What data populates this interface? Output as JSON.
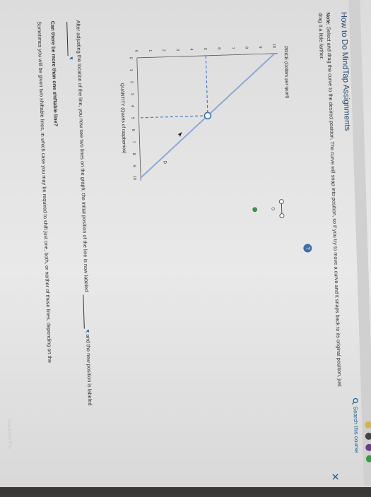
{
  "header": {
    "title": "How to Do MindTap Assignments",
    "search_label": "Search this course",
    "close_glyph": "✕",
    "rail_letter": "s"
  },
  "note": {
    "label": "Note",
    "text": ": Select and drag the curve to the desired position. The curve will snap into position, so if you try to move a curve and it snaps back to its original position, just drag it a little farther."
  },
  "help_glyph": "?",
  "chart_data": {
    "type": "line",
    "ylabel": "PRICE (Dollars per quart)",
    "xlabel": "QUANTITY (Quarts of raspberries)",
    "xlim": [
      0,
      10
    ],
    "ylim": [
      0,
      10
    ],
    "x_ticks": [
      "0",
      "1",
      "2",
      "3",
      "4",
      "5",
      "6",
      "7",
      "8",
      "9",
      "10"
    ],
    "y_ticks": [
      "0",
      "1",
      "2",
      "3",
      "4",
      "5",
      "6",
      "7",
      "8",
      "9",
      "10"
    ],
    "series": [
      {
        "name": "D",
        "x": [
          0,
          10
        ],
        "y": [
          10,
          0
        ],
        "color": "#8fa9d6"
      }
    ],
    "point": {
      "x": 5,
      "y": 5
    },
    "dashed_guides": true,
    "legend": [
      {
        "label": "D",
        "marker": "line-with-circles"
      },
      {
        "label": "",
        "marker": "dot",
        "color": "#2e9e3f"
      }
    ]
  },
  "after_text": {
    "part1": "After adjusting the location of the line, you now see two lines on the graph; the initial position of the line is now labeled",
    "part2": ", and the new position is labeled",
    "part3": "."
  },
  "question": {
    "title": "Can there be more than one shiftable line?",
    "text": "Sometimes you will be given two shiftable lines, in which case you may be required to shift just one, both, or neither of these lines, depending on the"
  },
  "watermark": "MacBook Pro",
  "colors": {
    "line": "#8fa9d6",
    "guide": "#4a78c8",
    "accent": "#1f5f8b",
    "title": "#2e4e6e"
  }
}
